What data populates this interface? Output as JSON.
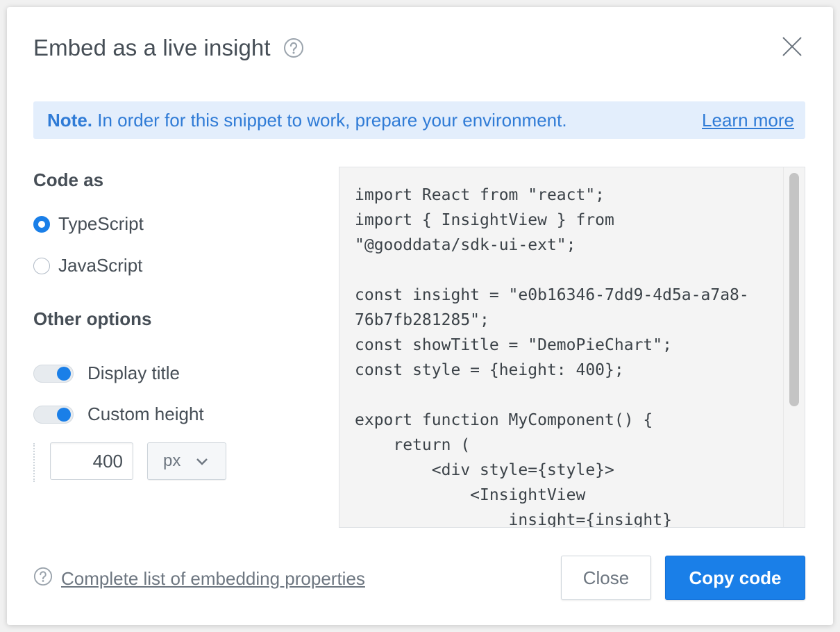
{
  "dialog": {
    "title": "Embed as a live insight",
    "help_icon": "question-circle-icon",
    "close_icon": "close-icon"
  },
  "note": {
    "label": "Note.",
    "text": "In order for this snippet to work, prepare your environment.",
    "link": "Learn more"
  },
  "code_as": {
    "heading": "Code as",
    "options": [
      {
        "label": "TypeScript",
        "selected": true
      },
      {
        "label": "JavaScript",
        "selected": false
      }
    ]
  },
  "other_options": {
    "heading": "Other options",
    "toggles": [
      {
        "label": "Display title",
        "on": true
      },
      {
        "label": "Custom height",
        "on": true
      }
    ],
    "height_value": "400",
    "unit": "px"
  },
  "code": "import React from \"react\";\nimport { InsightView } from\n\"@gooddata/sdk-ui-ext\";\n\nconst insight = \"e0b16346-7dd9-4d5a-a7a8-\n76b7fb281285\";\nconst showTitle = \"DemoPieChart\";\nconst style = {height: 400};\n\nexport function MyComponent() {\n    return (\n        <div style={style}>\n            <InsightView\n                insight={insight}",
  "footer": {
    "link": "Complete list of embedding properties",
    "close_label": "Close",
    "copy_label": "Copy code"
  },
  "colors": {
    "accent": "#1a7fe8",
    "note_bg": "#e3eefc",
    "text": "#464e56"
  }
}
